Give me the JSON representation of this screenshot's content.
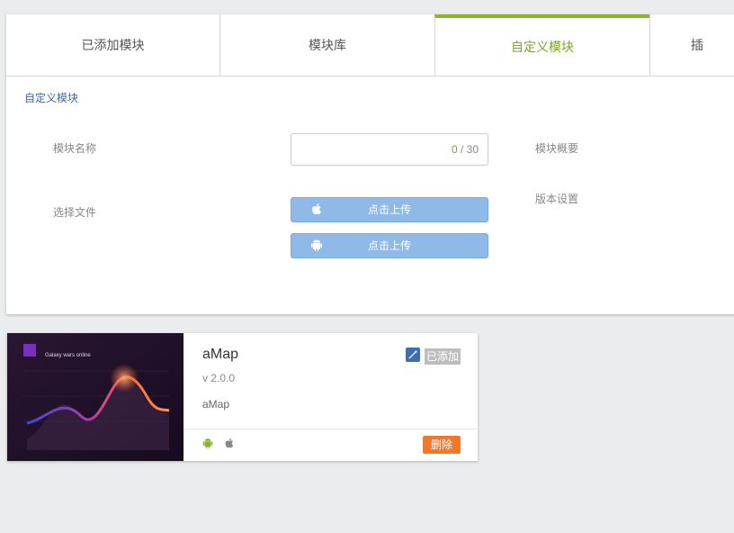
{
  "tabs": [
    {
      "label": "已添加模块"
    },
    {
      "label": "模块库"
    },
    {
      "label": "自定义模块"
    },
    {
      "label": "插"
    }
  ],
  "form": {
    "section_title": "自定义模块",
    "name_label": "模块名称",
    "name_counter_current": "0",
    "name_counter_sep": " / ",
    "name_counter_max": "30",
    "summary_label": "模块概要",
    "file_label": "选择文件",
    "version_label": "版本设置",
    "upload_ios_label": "点击上传",
    "upload_android_label": "点击上传"
  },
  "module_card": {
    "thumb_title": "Galaxy wars online",
    "title": "aMap",
    "version": "v 2.0.0",
    "description": "aMap",
    "added_badge": "已添加",
    "delete_label": "删除"
  },
  "colors": {
    "accent_green": "#8bb32f",
    "link_blue": "#3a6aa8",
    "upload_blue": "#8fb9e6",
    "delete_orange": "#f07828"
  }
}
